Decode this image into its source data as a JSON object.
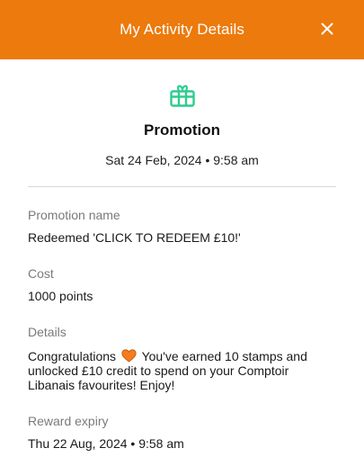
{
  "header": {
    "title": "My Activity Details",
    "close_icon": "close-icon",
    "background_color": "#ec7a0c"
  },
  "hero": {
    "icon": "gift-icon",
    "icon_color": "#2ecc8f",
    "title": "Promotion",
    "date": "Sat 24 Feb, 2024 • 9:58 am"
  },
  "fields": {
    "promotion_name_label": "Promotion name",
    "promotion_name_value": "Redeemed 'CLICK TO REDEEM £10!'",
    "cost_label": "Cost",
    "cost_value": "1000 points",
    "details_label": "Details",
    "details_prefix": "Congratulations",
    "details_icon": "heart-icon",
    "details_suffix": " You've earned 10 stamps and unlocked £10 credit to spend on your Comptoir Libanais favourites! Enjoy!",
    "expiry_label": "Reward expiry",
    "expiry_value": "Thu 22 Aug, 2024 • 9:58 am"
  }
}
